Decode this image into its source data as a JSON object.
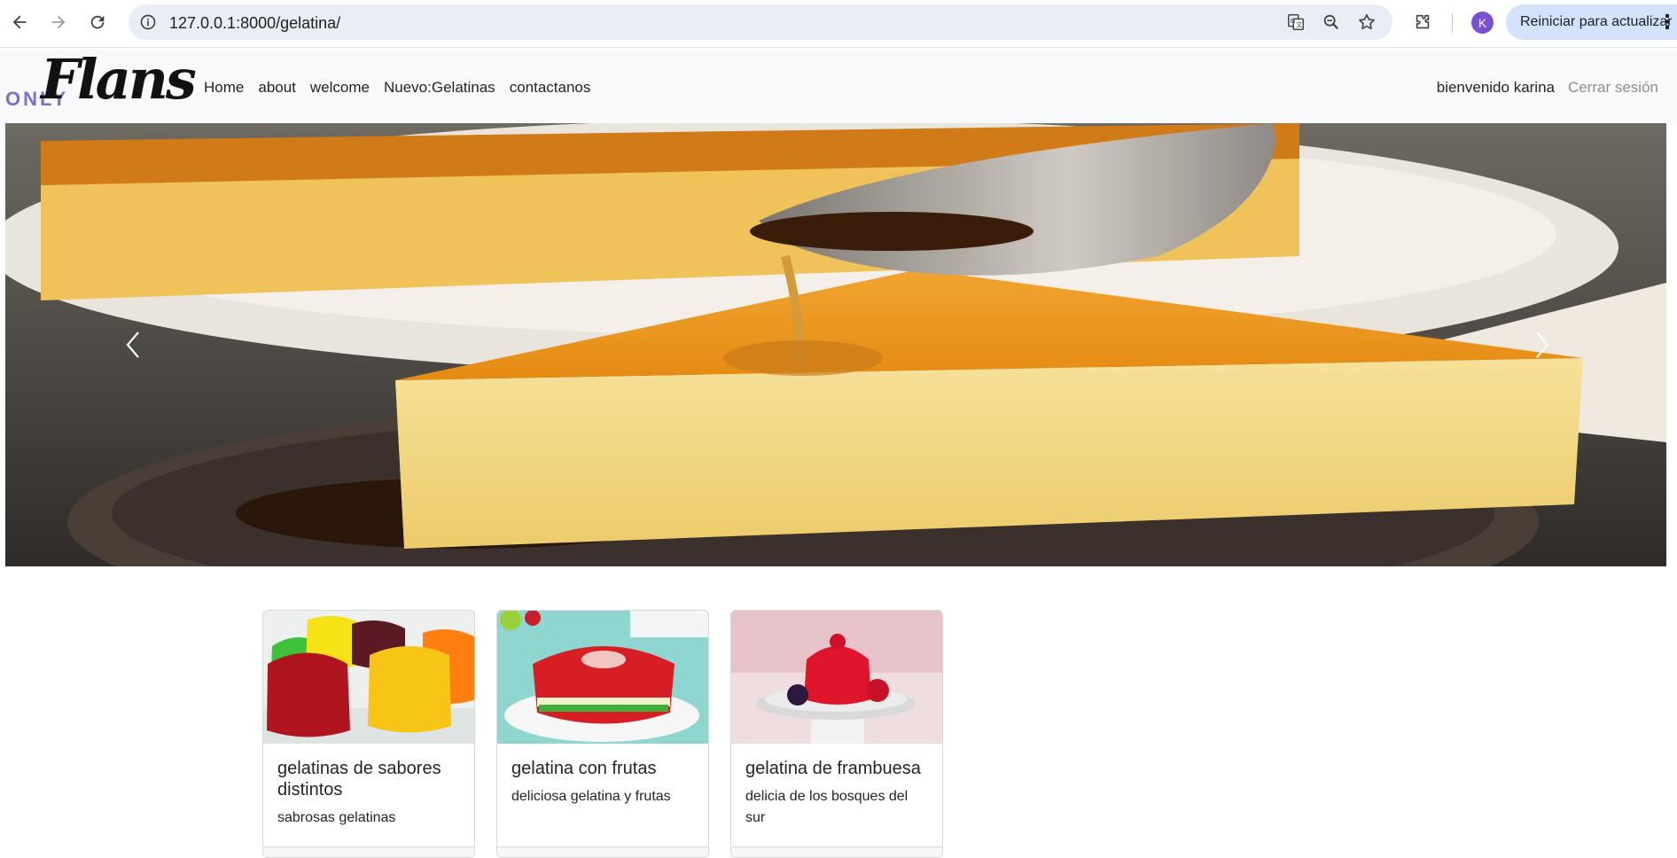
{
  "browser": {
    "url": "127.0.0.1:8000/gelatina/",
    "profile_initial": "K",
    "restart_label": "Reiniciar para actualizar",
    "icons": [
      "back-icon",
      "forward-icon",
      "reload-icon",
      "site-info-icon",
      "translate-icon",
      "zoom-icon",
      "bookmark-star-icon",
      "extensions-icon",
      "menu-dots-icon"
    ]
  },
  "nav": {
    "brand_small": "ONLY",
    "brand_script": "Flans",
    "links": [
      {
        "label": "Home"
      },
      {
        "label": "about"
      },
      {
        "label": "welcome"
      },
      {
        "label": "Nuevo:Gelatinas"
      },
      {
        "label": "contactanos"
      }
    ],
    "greeting": "bienvenido karina",
    "logout": "Cerrar sesión"
  },
  "hero": {
    "alt_subject": "flan-with-caramel-spoon",
    "prev_icon": "chevron-left-icon",
    "next_icon": "chevron-right-icon"
  },
  "cards": [
    {
      "title": "gelatinas de sabores distintos",
      "text": "sabrosas gelatinas",
      "image": "assorted-gelatins"
    },
    {
      "title": "gelatina con frutas",
      "text": "deliciosa gelatina y frutas",
      "image": "fruit-ring-gelatin"
    },
    {
      "title": "gelatina de frambuesa",
      "text": "delicia de los bosques del sur",
      "image": "raspberry-gelatin"
    }
  ],
  "colors": {
    "nav_bg": "#f8f9fa",
    "omnibox_bg": "#e9eef6",
    "restart_bg": "#d3e3fd",
    "brand_accent": "#7b6fc9",
    "avatar": "#7a4fd1"
  }
}
